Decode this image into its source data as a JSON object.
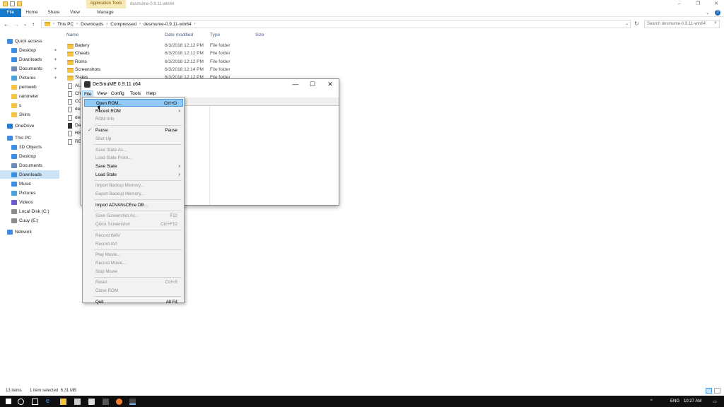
{
  "explorer": {
    "title": "desmume-0.9.11-win64",
    "context_tab_group": "Application Tools",
    "ribbon_tabs": [
      "File",
      "Home",
      "Share",
      "View",
      "Manage"
    ],
    "window_controls": [
      "–",
      "❐",
      "✕"
    ],
    "address": [
      "This PC",
      "Downloads",
      "Compressed",
      "desmume-0.9.11-win64"
    ],
    "search_placeholder": "Search desmume-0.9.11-win64",
    "columns": [
      "Name",
      "Date modified",
      "Type",
      "Size"
    ],
    "nav": [
      {
        "label": "Quick access",
        "kind": "star"
      },
      {
        "label": "Desktop",
        "kind": "blue",
        "pinned": true
      },
      {
        "label": "Downloads",
        "kind": "down",
        "pinned": true
      },
      {
        "label": "Documents",
        "kind": "doc",
        "pinned": true
      },
      {
        "label": "Pictures",
        "kind": "pic",
        "pinned": true
      },
      {
        "label": "pemweb",
        "kind": "folder"
      },
      {
        "label": "rainmeter",
        "kind": "folder"
      },
      {
        "label": "s",
        "kind": "folder"
      },
      {
        "label": "Skins",
        "kind": "folder"
      },
      {
        "label": "OneDrive",
        "kind": "cloud"
      },
      {
        "label": "This PC",
        "kind": "pc"
      },
      {
        "label": "3D Objects",
        "kind": "blue"
      },
      {
        "label": "Desktop",
        "kind": "blue"
      },
      {
        "label": "Documents",
        "kind": "doc"
      },
      {
        "label": "Downloads",
        "kind": "down",
        "selected": true
      },
      {
        "label": "Music",
        "kind": "music"
      },
      {
        "label": "Pictures",
        "kind": "pic"
      },
      {
        "label": "Videos",
        "kind": "vid"
      },
      {
        "label": "Local Disk (C:)",
        "kind": "disk"
      },
      {
        "label": "Cuuy (E:)",
        "kind": "disk"
      },
      {
        "label": "Network",
        "kind": "net"
      }
    ],
    "files": [
      {
        "name": "Battery",
        "date": "6/3/2018 12:12 PM",
        "type": "File folder",
        "kind": "folder"
      },
      {
        "name": "Cheats",
        "date": "6/3/2018 12:12 PM",
        "type": "File folder",
        "kind": "folder"
      },
      {
        "name": "Roms",
        "date": "6/3/2018 12:12 PM",
        "type": "File folder",
        "kind": "folder"
      },
      {
        "name": "Screenshots",
        "date": "6/3/2018 12:14 PM",
        "type": "File folder",
        "kind": "folder"
      },
      {
        "name": "States",
        "date": "6/3/2018 12:12 PM",
        "type": "File folder",
        "kind": "folder"
      },
      {
        "name": "AU",
        "date": "",
        "type": "",
        "kind": "file"
      },
      {
        "name": "Ch",
        "date": "",
        "type": "",
        "kind": "file"
      },
      {
        "name": "CO",
        "date": "",
        "type": "",
        "kind": "file"
      },
      {
        "name": "des",
        "date": "",
        "type": "",
        "kind": "file"
      },
      {
        "name": "des",
        "date": "",
        "type": "",
        "kind": "file"
      },
      {
        "name": "De",
        "date": "",
        "type": "",
        "kind": "app"
      },
      {
        "name": "REA",
        "date": "",
        "type": "",
        "kind": "file"
      },
      {
        "name": "REA",
        "date": "",
        "type": "",
        "kind": "file"
      }
    ],
    "status": {
      "count": "13 items",
      "selection": "1 item selected  6.31 MB"
    }
  },
  "desmume": {
    "title": "DeSmuME 0.9.11 x64",
    "menubar": [
      "File",
      "View",
      "Config",
      "Tools",
      "Help"
    ],
    "controls": [
      "—",
      "☐",
      "✕"
    ],
    "file_menu": [
      {
        "label": "Open ROM...",
        "shortcut": "Ctrl+O",
        "state": "highlight"
      },
      {
        "label": "Recent ROM",
        "submenu": true
      },
      {
        "label": "ROM Info",
        "state": "disabled"
      },
      {
        "sep": true
      },
      {
        "label": "Pause",
        "shortcut": "Pause",
        "checked": true
      },
      {
        "label": "Shut Up",
        "state": "disabled"
      },
      {
        "sep": true
      },
      {
        "label": "Save State As...",
        "state": "disabled"
      },
      {
        "label": "Load State From...",
        "state": "disabled"
      },
      {
        "label": "Save State",
        "submenu": true
      },
      {
        "label": "Load State",
        "submenu": true
      },
      {
        "sep": true
      },
      {
        "label": "Import Backup Memory...",
        "state": "disabled"
      },
      {
        "label": "Export Backup Memory...",
        "state": "disabled"
      },
      {
        "sep": true
      },
      {
        "label": "Import ADVANsCEne DB..."
      },
      {
        "sep": true
      },
      {
        "label": "Save Screenshot As...",
        "shortcut": "F12",
        "state": "disabled"
      },
      {
        "label": "Quick Screenshot",
        "shortcut": "Ctrl+F12",
        "state": "disabled"
      },
      {
        "sep": true
      },
      {
        "label": "Record WAV",
        "state": "disabled"
      },
      {
        "label": "Record AVI",
        "state": "disabled"
      },
      {
        "sep": true
      },
      {
        "label": "Play Movie...",
        "state": "disabled"
      },
      {
        "label": "Record Movie...",
        "state": "disabled"
      },
      {
        "label": "Stop Movie",
        "state": "disabled"
      },
      {
        "sep": true
      },
      {
        "label": "Reset",
        "shortcut": "Ctrl+R",
        "state": "disabled"
      },
      {
        "label": "Close ROM",
        "state": "disabled"
      },
      {
        "sep": true
      },
      {
        "label": "Quit",
        "shortcut": "Alt F4"
      }
    ]
  },
  "taskbar": {
    "lang": "ENG",
    "time": "10:27 AM"
  },
  "colors": {
    "accent": "#1979ca",
    "folder": "#f4c542",
    "menu_highlight": "#91c9f7"
  }
}
